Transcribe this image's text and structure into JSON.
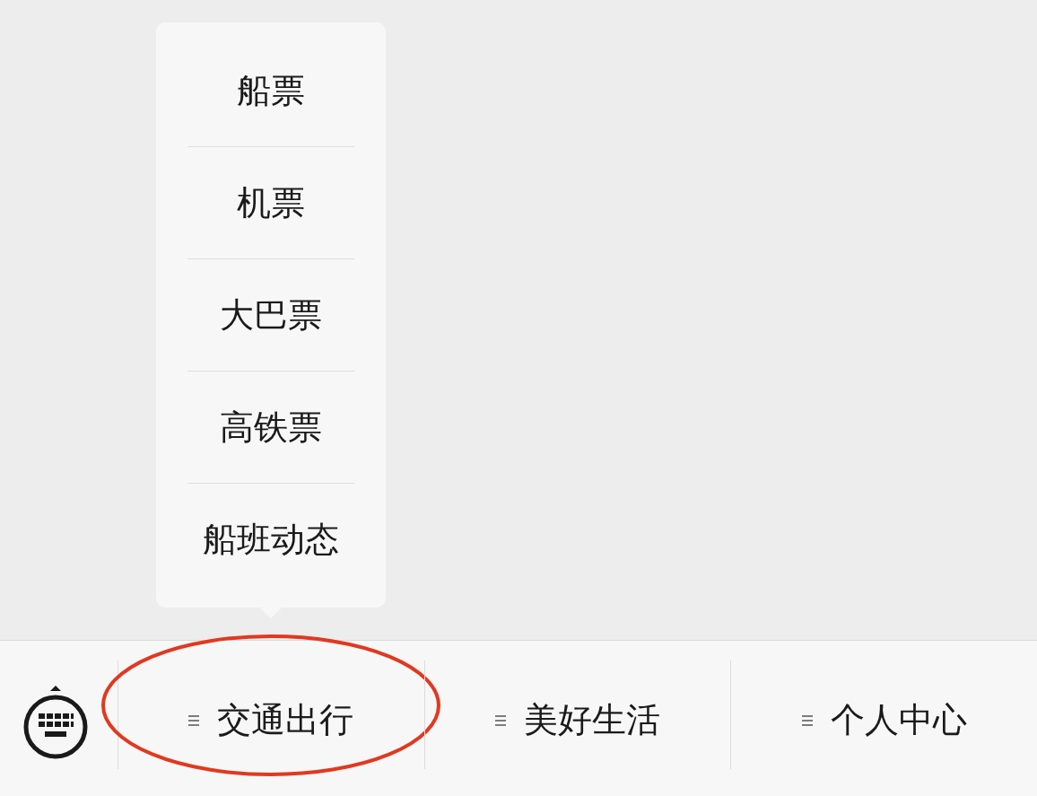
{
  "menus": [
    {
      "label": "交通出行",
      "circled": true,
      "submenu": [
        "船票",
        "机票",
        "大巴票",
        "高铁票",
        "船班动态"
      ]
    },
    {
      "label": "美好生活",
      "circled": false
    },
    {
      "label": "个人中心",
      "circled": false
    }
  ]
}
